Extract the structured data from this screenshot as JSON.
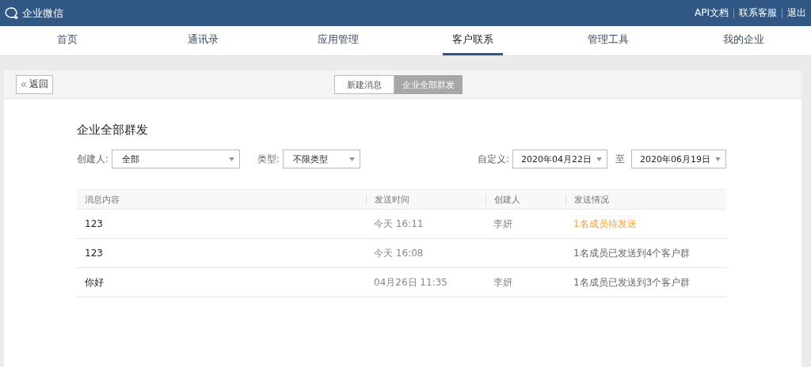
{
  "header": {
    "logo": "企业微信",
    "links": [
      "API文档",
      "联系客服",
      "退出"
    ]
  },
  "nav": [
    {
      "label": "首页",
      "selected": false
    },
    {
      "label": "通讯录",
      "selected": false
    },
    {
      "label": "应用管理",
      "selected": false
    },
    {
      "label": "客户联系",
      "selected": true
    },
    {
      "label": "管理工具",
      "selected": false
    },
    {
      "label": "我的企业",
      "selected": false
    }
  ],
  "back_button": "返回",
  "segments": [
    {
      "label": "新建消息",
      "selected": false
    },
    {
      "label": "企业全部群发",
      "selected": true
    }
  ],
  "title": "企业全部群发",
  "filters": {
    "creator_label": "创建人:",
    "creator": "全部",
    "type_label": "类型:",
    "type": "不限类型",
    "range_label": "自定义:",
    "from": "2020年04月22日",
    "to_label": "至",
    "to": "2020年06月19日"
  },
  "table": {
    "columns": [
      "消息内容",
      "发送时间",
      "创建人",
      "发送情况"
    ],
    "rows": [
      {
        "content": "123",
        "time": "今天 16:11",
        "creator": "李妍",
        "status": "1名成员待发送",
        "kind": "pending"
      },
      {
        "content": "123",
        "time": "今天 16:08",
        "status": "1名成员已发送到4个客户群",
        "kind": "sent"
      },
      {
        "content": "你好",
        "time": "04月26日 11:35",
        "creator": "李妍",
        "status": "1名成员已发送到3个客户群",
        "kind": "sent"
      }
    ]
  }
}
